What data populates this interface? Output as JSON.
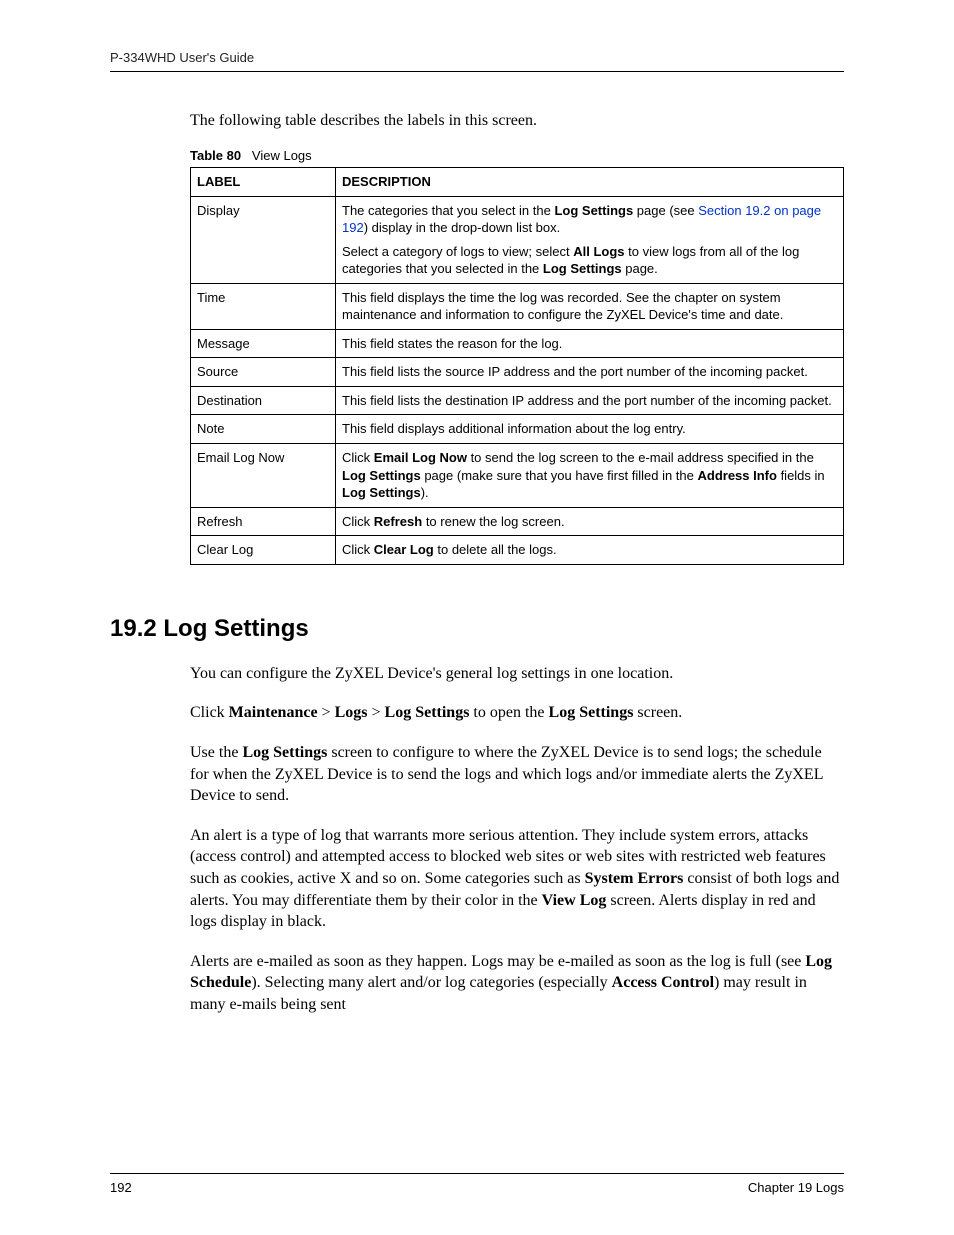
{
  "header": {
    "running_head": "P-334WHD User's Guide"
  },
  "intro": "The following table describes the labels in this screen.",
  "table": {
    "caption_label": "Table 80",
    "caption_title": "View Logs",
    "headers": {
      "col1": "LABEL",
      "col2": "DESCRIPTION"
    },
    "rows": [
      {
        "label": "Display",
        "desc_parts": {
          "p1a": "The categories that you select in the ",
          "p1b_bold": "Log Settings",
          "p1c": " page (see ",
          "p1d_link": "Section 19.2 on page 192",
          "p1e": ") display in the drop-down list box.",
          "p2a": "Select a category of logs to view; select ",
          "p2b_bold": "All Logs",
          "p2c": " to view logs from all of the log categories that you selected in the ",
          "p2d_bold": "Log Settings",
          "p2e": " page."
        }
      },
      {
        "label": "Time",
        "desc": "This field displays the time the log was recorded. See the chapter on system maintenance and information to configure the ZyXEL Device's time and date."
      },
      {
        "label": "Message",
        "desc": "This field states the reason for the log."
      },
      {
        "label": "Source",
        "desc": "This field lists the source IP address and the port number of the incoming packet."
      },
      {
        "label": "Destination",
        "desc": "This field lists the destination IP address and the port number of the incoming packet."
      },
      {
        "label": "Note",
        "desc": "This field displays additional information about the log entry."
      },
      {
        "label": "Email Log Now",
        "desc_parts": {
          "a": "Click ",
          "b_bold": "Email Log Now",
          "c": " to send the log screen to the e-mail address specified in the ",
          "d_bold": "Log Settings",
          "e": " page (make sure that you have first filled in the ",
          "f_bold": "Address Info",
          "g": " fields in ",
          "h_bold": "Log Settings",
          "i": ")."
        }
      },
      {
        "label": "Refresh",
        "desc_parts": {
          "a": "Click ",
          "b_bold": "Refresh",
          "c": " to renew the log screen."
        }
      },
      {
        "label": "Clear Log",
        "desc_parts": {
          "a": "Click ",
          "b_bold": "Clear Log",
          "c": " to delete all the logs."
        }
      }
    ]
  },
  "section": {
    "heading": "19.2  Log Settings",
    "p1": "You can configure the ZyXEL Device's general log settings in one location.",
    "p2": {
      "a": "Click ",
      "b_bold": "Maintenance",
      "c": " > ",
      "d_bold": "Logs",
      "e": " > ",
      "f_bold": "Log Settings",
      "g": " to open the ",
      "h_bold": "Log Settings",
      "i": " screen."
    },
    "p3": {
      "a": "Use the ",
      "b_bold": "Log Settings",
      "c": " screen to configure to where the ZyXEL Device is to send logs; the schedule for when the ZyXEL Device is to send the logs and which logs and/or immediate alerts the ZyXEL Device to send."
    },
    "p4": {
      "a": "An alert is a type of log that warrants more serious attention. They include system errors, attacks (access control) and attempted access to blocked web sites or web sites with restricted web features such as cookies, active X and so on. Some categories such as ",
      "b_bold": "System Errors",
      "c": " consist of both logs and alerts. You may differentiate them by their color in the ",
      "d_bold": "View Log",
      "e": " screen. Alerts display in red and logs display in black."
    },
    "p5": {
      "a": "Alerts are e-mailed as soon as they happen. Logs may be e-mailed as soon as the log is full (see ",
      "b_bold": "Log Schedule",
      "c": "). Selecting many alert and/or log categories (especially ",
      "d_bold": "Access Control",
      "e": ") may result in many e-mails being sent"
    }
  },
  "footer": {
    "page_number": "192",
    "chapter": "Chapter 19 Logs"
  }
}
